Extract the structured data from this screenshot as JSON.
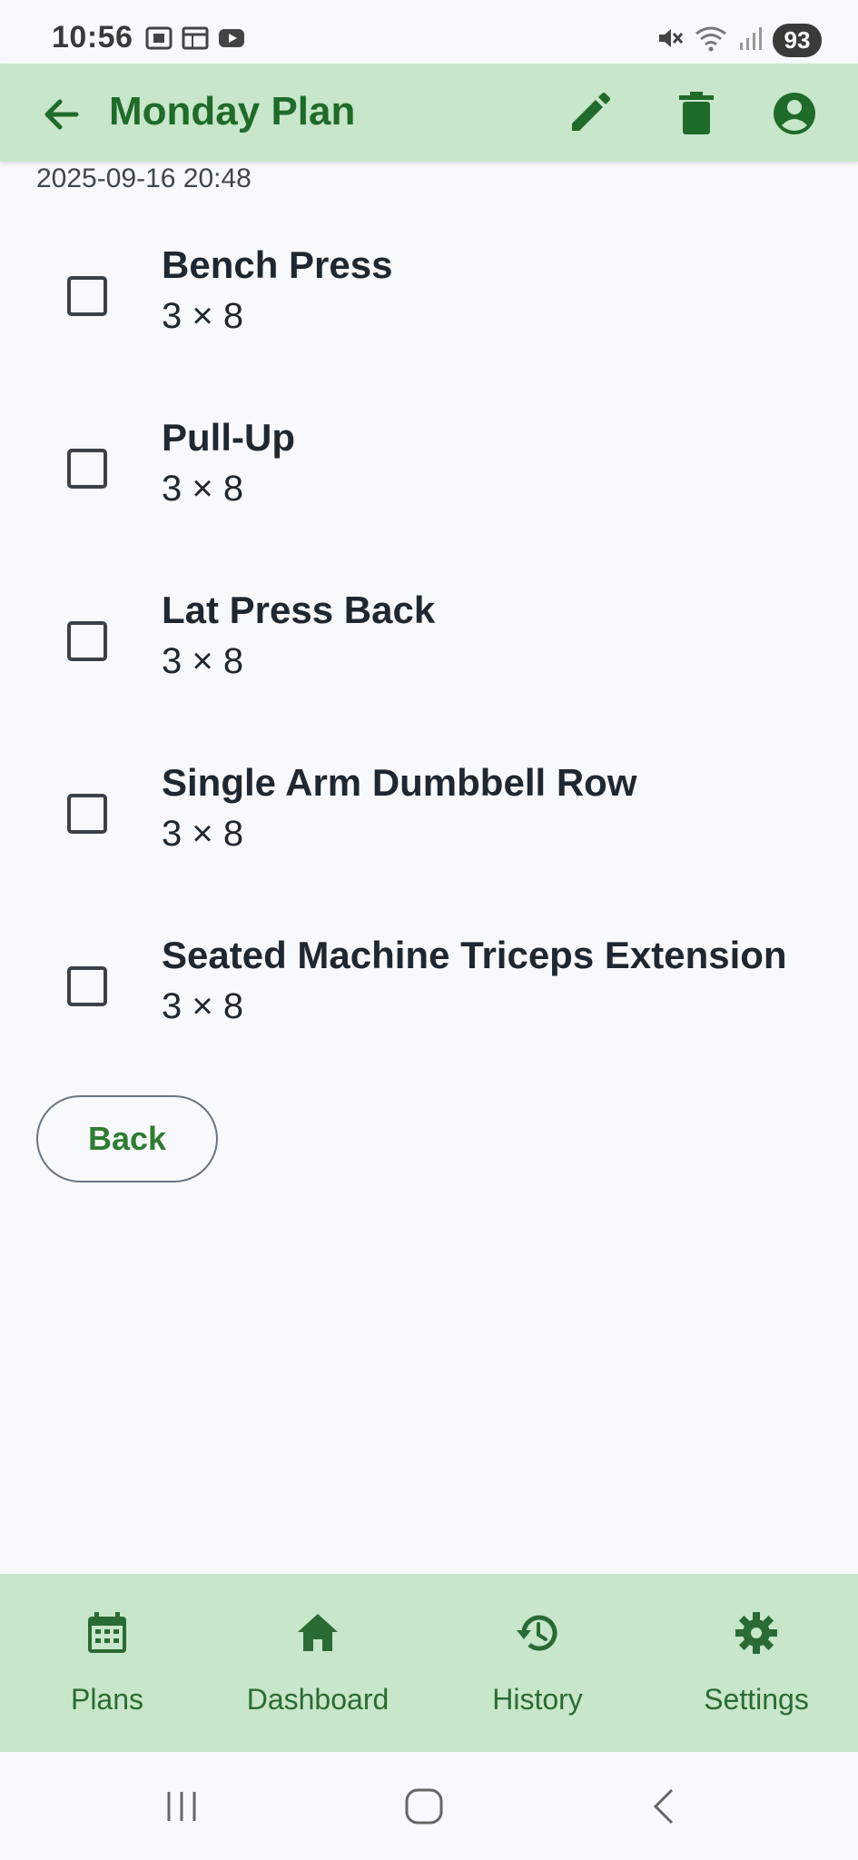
{
  "status_bar": {
    "time": "10:56",
    "battery": "93",
    "icons_left": [
      "screenshot-icon",
      "calendar-icon",
      "youtube-icon"
    ],
    "icons_right": [
      "mute-icon",
      "wifi-icon",
      "signal-icon"
    ]
  },
  "app_bar": {
    "title": "Monday Plan",
    "actions": [
      "edit-icon",
      "delete-icon",
      "account-icon"
    ]
  },
  "plan": {
    "date": "2025-09-16 20:48",
    "exercises": [
      {
        "name": "Bench Press",
        "detail": "3 × 8",
        "checked": false
      },
      {
        "name": "Pull-Up",
        "detail": "3 × 8",
        "checked": false
      },
      {
        "name": "Lat Press Back",
        "detail": "3 × 8",
        "checked": false
      },
      {
        "name": "Single Arm Dumbbell Row",
        "detail": "3 × 8",
        "checked": false
      },
      {
        "name": "Seated Machine Triceps Extension",
        "detail": "3 × 8",
        "checked": false
      }
    ],
    "back_label": "Back"
  },
  "bottom_nav": {
    "items": [
      {
        "label": "Plans",
        "icon": "calendar-icon"
      },
      {
        "label": "Dashboard",
        "icon": "home-icon"
      },
      {
        "label": "History",
        "icon": "history-icon"
      },
      {
        "label": "Settings",
        "icon": "gear-icon"
      }
    ]
  },
  "colors": {
    "accent": "#2e7d32",
    "bar_background": "#c8e6c9",
    "page_background": "#f7f9fc"
  }
}
